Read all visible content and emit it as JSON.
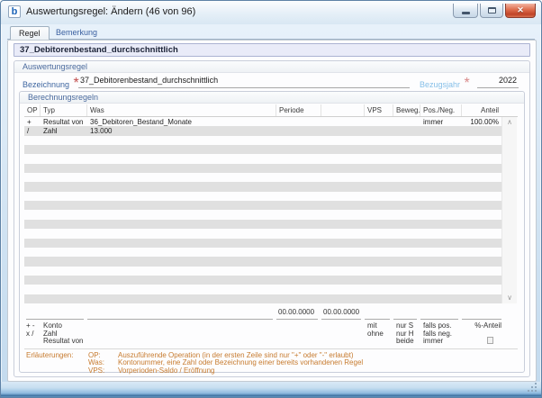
{
  "window": {
    "title": "Auswertungsregel: Ändern (46 von 96)",
    "icon_letter": "b",
    "close_glyph": "✕"
  },
  "tabs": [
    {
      "label": "Regel",
      "active": true
    },
    {
      "label": "Bemerkung",
      "active": false
    }
  ],
  "rule_header": "37_Debitorenbestand_durchschnittlich",
  "auswertungsregel": {
    "title": "Auswertungsregel",
    "bezeichnung_label": "Bezeichnung",
    "bezeichnung_required": "*",
    "bezeichnung_value": "37_Debitorenbestand_durchschnittlich",
    "bezugsjahr_label": "Bezugsjahr",
    "bezugsjahr_required": "*",
    "bezugsjahr_value": "2022"
  },
  "berechnungsregeln": {
    "title": "Berechnungsregeln",
    "table": {
      "columns": [
        "OP",
        "Typ",
        "Was",
        "Periode",
        "",
        "VPS",
        "Beweg.",
        "Pos./Neg.",
        "Anteil"
      ],
      "rows": [
        {
          "op": "+",
          "typ": "Resultat von",
          "was": "36_Debitoren_Bestand_Monate",
          "periode1": "",
          "periode2": "",
          "vps": "",
          "beweg": "",
          "posneg": "immer",
          "anteil": "100.00%"
        },
        {
          "op": "/",
          "typ": "Zahl",
          "was": "13.000",
          "periode1": "",
          "periode2": "",
          "vps": "",
          "beweg": "",
          "posneg": "",
          "anteil": ""
        }
      ],
      "empty_row_count": 18,
      "scroll_up_glyph": "∧",
      "scroll_down_glyph": "∨"
    },
    "edit_row": {
      "periode1": "00.00.0000",
      "periode2": "00.00.0000"
    },
    "legend": {
      "op_line1": "+ -",
      "op_line2": "x /",
      "typ_line1": "Konto",
      "typ_line2": "Zahl",
      "typ_line3": "Resultat von",
      "vps_line1": "mit",
      "vps_line2": "ohne",
      "beweg_line1": "nur S",
      "beweg_line2": "nur H",
      "beweg_line3": "beide",
      "posneg_line1": "falls pos.",
      "posneg_line2": "falls neg.",
      "posneg_line3": "immer",
      "anteil_label": "%-Anteil"
    },
    "erlaeuterungen": {
      "title": "Erläuterungen:",
      "items": [
        {
          "term": "OP:",
          "text": "Auszuführende Operation (in der ersten Zeile sind nur \"+\" oder \"-\" erlaubt)"
        },
        {
          "term": "Was:",
          "text": "Kontonummer, eine Zahl oder Bezeichnung einer bereits vorhandenen Regel"
        },
        {
          "term": "VPS:",
          "text": "Vorperioden-Saldo / Eröffnung"
        }
      ]
    }
  },
  "colors": {
    "label_blue": "#3E66A0",
    "light_blue_label": "#85BFE8",
    "required_red": "#C24F4F",
    "orange_help": "#C77B2F",
    "stripe_gray": "#E0E0E0",
    "header_lavender": "#E9EBF8",
    "close_red": "#C04326"
  }
}
